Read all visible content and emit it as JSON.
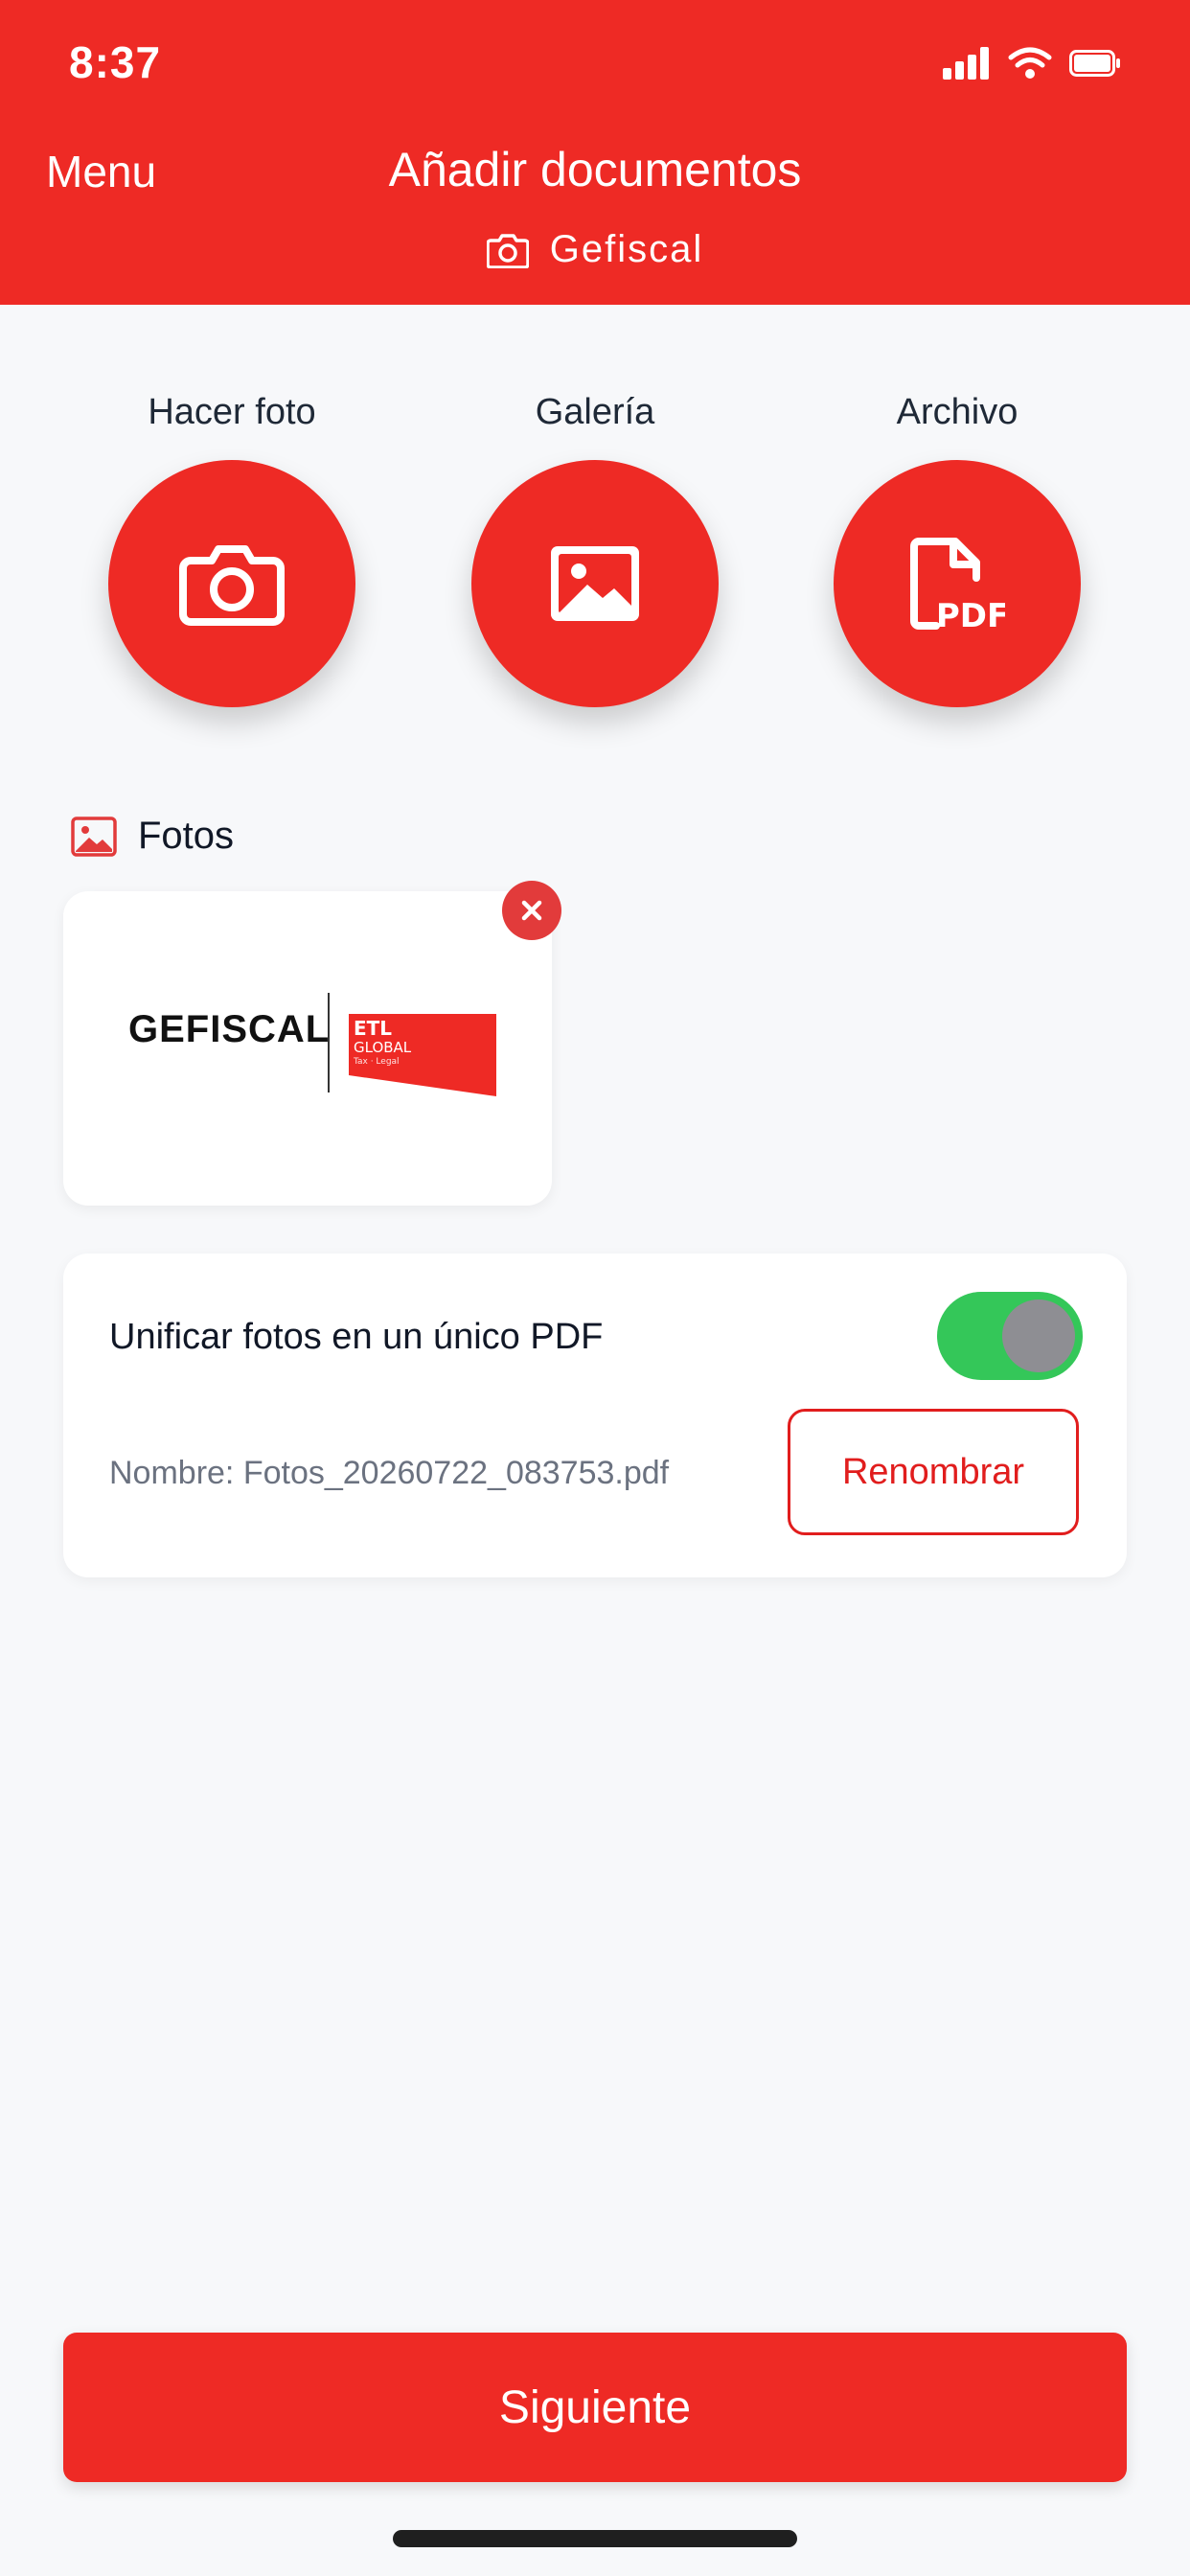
{
  "status_bar": {
    "time": "8:37",
    "icons": [
      "signal-icon",
      "wifi-icon",
      "battery-icon"
    ]
  },
  "header": {
    "menu_label": "Menu",
    "title": "Añadir documentos",
    "subtitle": "Gefiscal",
    "subtitle_icon": "camera-icon",
    "background_color": "#ee2a25"
  },
  "actions": [
    {
      "label": "Hacer foto",
      "icon": "camera-icon"
    },
    {
      "label": "Galería",
      "icon": "image-icon"
    },
    {
      "label": "Archivo",
      "icon": "pdf-file-icon",
      "icon_text": "PDF"
    }
  ],
  "photos": {
    "section_title": "Fotos",
    "items": [
      {
        "logo_text": "GEFISCAL",
        "badge_lines": [
          "ETL",
          "GLOBAL",
          "Tax · Legal"
        ]
      }
    ]
  },
  "options": {
    "unify_label": "Unificar fotos en un único PDF",
    "unify_enabled": true,
    "file_name": "Nombre: Fotos_20260722_083753.pdf",
    "rename_label": "Renombrar"
  },
  "footer": {
    "next_label": "Siguiente"
  },
  "colors": {
    "accent": "#ee2a25",
    "toggle_on": "#34c759",
    "background": "#f7f8fa"
  }
}
